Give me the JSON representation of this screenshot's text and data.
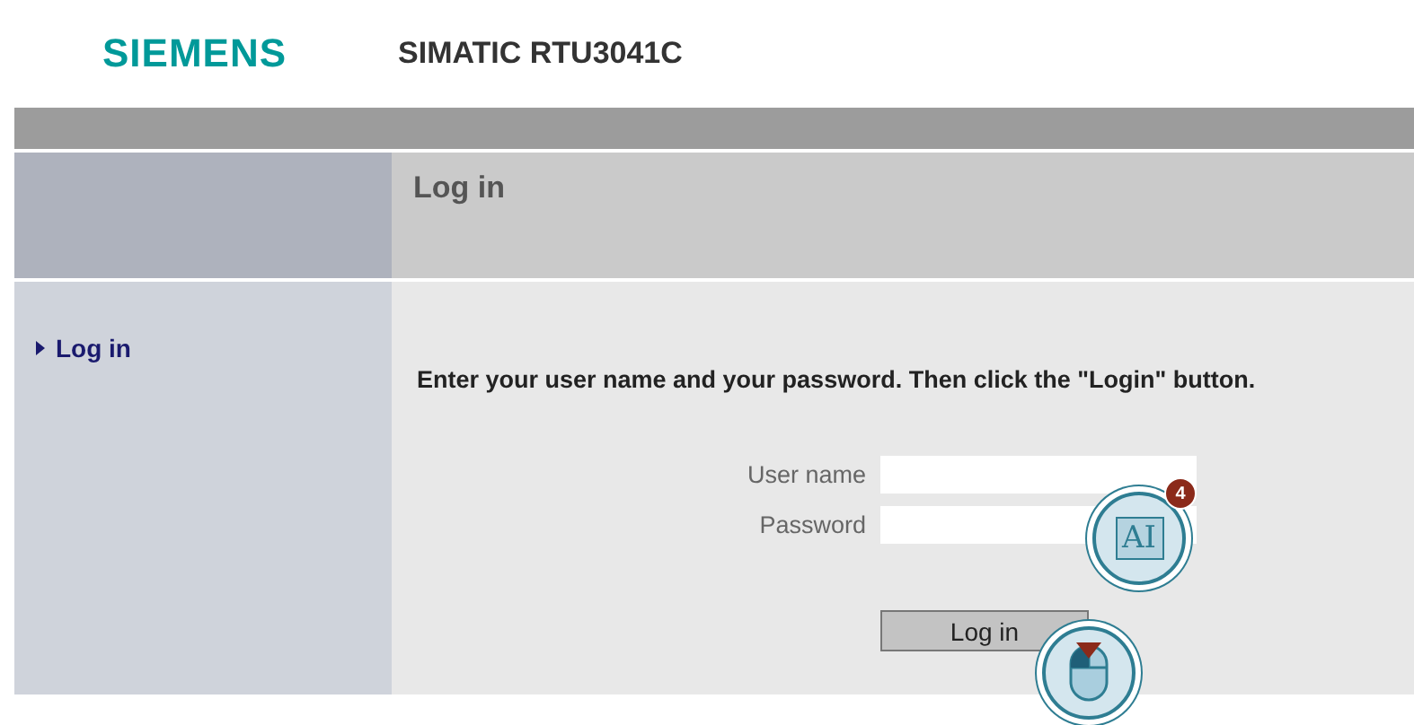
{
  "header": {
    "logo": "SIEMENS",
    "product": "SIMATIC RTU3041C"
  },
  "page_title": "Log in",
  "sidebar": {
    "items": [
      {
        "label": "Log in",
        "selected": true
      }
    ]
  },
  "instruction": "Enter your user name and your password. Then click the \"Login\" button.",
  "form": {
    "fields": [
      {
        "label": "User name"
      },
      {
        "label": "Password"
      }
    ],
    "button": "Log in"
  },
  "callouts": [
    {
      "kind": "keyboard",
      "label": "AI",
      "badge": "4"
    },
    {
      "kind": "mouse"
    }
  ]
}
